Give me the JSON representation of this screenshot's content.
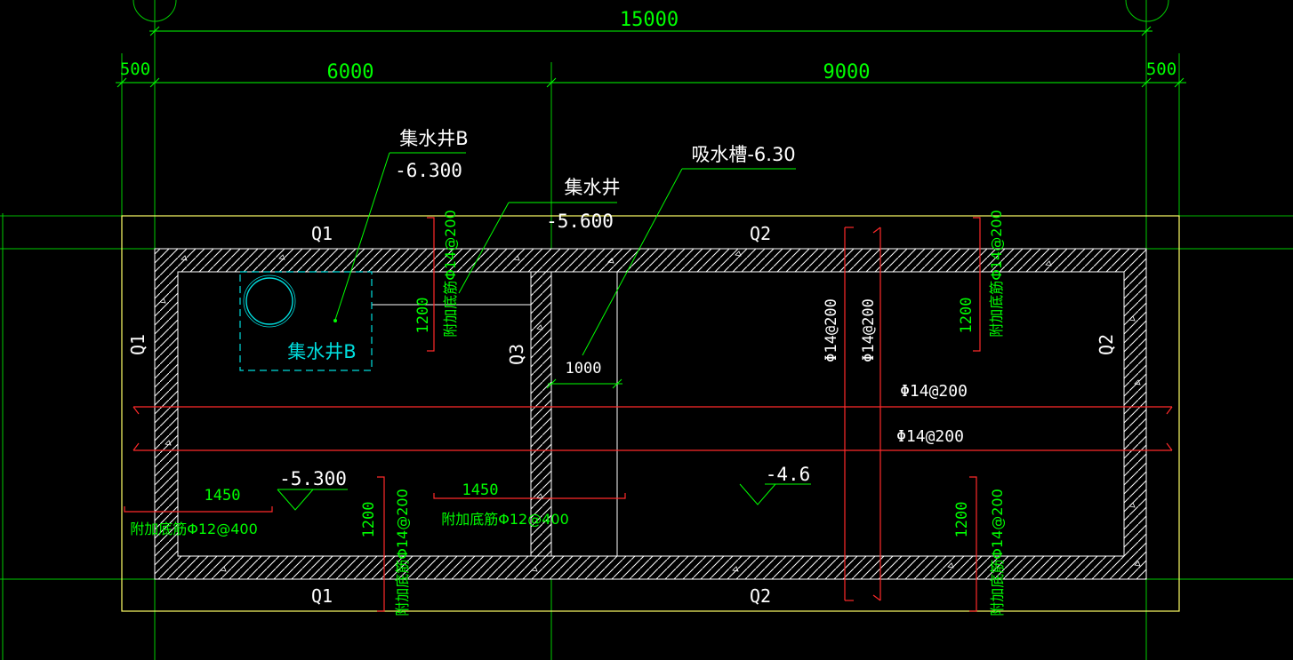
{
  "colors": {
    "background": "#000000",
    "dimension": "#00ff00",
    "wall_text": "#ffffff",
    "rebar": "#ff2a2a",
    "boundary": "#ffff66",
    "pit": "#00dddd",
    "linework": "#ffffff"
  },
  "dimensions": {
    "total": "15000",
    "left_edge": "500",
    "left_span": "6000",
    "right_span": "9000",
    "right_edge": "500"
  },
  "callouts": {
    "sump_b_name": "集水井B",
    "sump_b_elev": "-6.300",
    "sump_name": "集水井",
    "sump_elev": "-5.600",
    "trough": "吸水槽-6.30"
  },
  "walls": {
    "top_left": "Q1",
    "top_right": "Q2",
    "bottom_left": "Q1",
    "bottom_right": "Q2",
    "left": "Q1",
    "right": "Q2",
    "middle": "Q3"
  },
  "rebar_labels": {
    "top_left_add": "附加底筋Φ14@200",
    "top_left_len": "1200",
    "top_right_add": "附加底筋Φ14@200",
    "top_right_len": "1200",
    "bottom_left_add": "附加底筋Φ14@200",
    "bottom_left_len": "1200",
    "bottom_right_add": "附加底筋Φ14@200",
    "bottom_right_len": "1200",
    "vert_1": "Φ14@200",
    "vert_2": "Φ14@200",
    "horiz_1": "Φ14@200",
    "horiz_2": "Φ14@200",
    "left_add": "附加底筋Φ12@400",
    "left_len": "1450",
    "mid_add": "附加底筋Φ12@400",
    "mid_len": "1450",
    "trough_width": "1000"
  },
  "elevations": {
    "left_floor": "-5.300",
    "right_floor": "-4.6"
  },
  "pit_label": "集水井B"
}
